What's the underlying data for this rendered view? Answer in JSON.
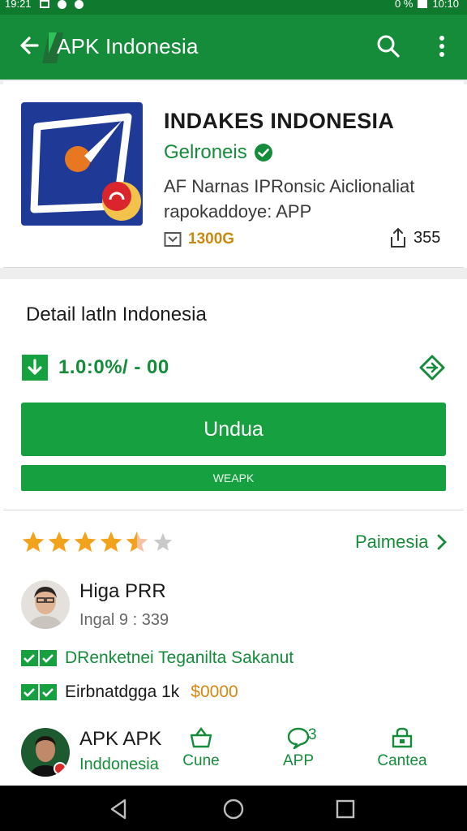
{
  "status_bar": {
    "left_text": "19:21",
    "right_text": "0 %",
    "time": "10:10"
  },
  "appbar": {
    "title": "APK Indonesia",
    "icons": [
      "back-arrow-icon",
      "search-icon",
      "more-vert-icon"
    ]
  },
  "app": {
    "name": "INDAKES INDONESIA",
    "developer": "Gelroneis",
    "description_lines": [
      "AF Narnas IPRonsic Aiclionaliat",
      "rapokaddoye: APP"
    ],
    "size": "1300G",
    "share_count": "355"
  },
  "download": {
    "title": "Detail latln Indonesia",
    "version": "1.0:0%/ - 00",
    "primary_label": "Undua",
    "secondary_label": "WEAPK"
  },
  "reviews": {
    "rating": 4.5,
    "more_label": "Paimesia",
    "reviewer_name": "Higa PRR",
    "reviewer_sub": "Ingal 9 : 339",
    "check_line_1": "DRenketnei Teganilta Sakanut",
    "check_line_2": "Eirbnatdgga 1k",
    "check_line_2_price": "$0000",
    "bottom_name": "APK APK",
    "bottom_sub": "Inddonesia",
    "actions": [
      {
        "label": "Cune",
        "icon": "basket-icon"
      },
      {
        "label": "APP",
        "icon": "chat-bubble-icon",
        "count": "3"
      },
      {
        "label": "Cantea",
        "icon": "shop-icon"
      }
    ]
  },
  "colors": {
    "appbar": "#148c3a",
    "accent_green": "#17a040",
    "star": "#f2a31b",
    "price_orange": "#d9860f"
  }
}
